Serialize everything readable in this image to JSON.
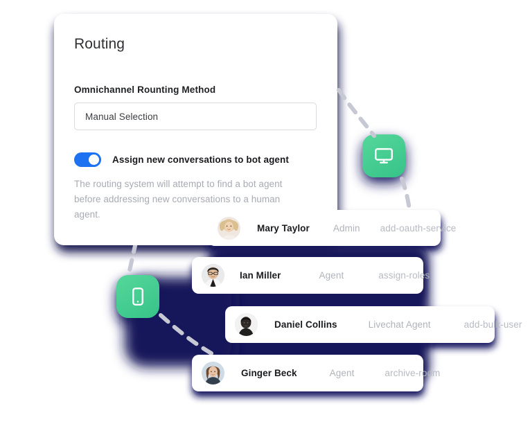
{
  "routing_panel": {
    "title": "Routing",
    "method_label": "Omnichannel Rounting Method",
    "method_value": "Manual Selection",
    "toggle_label": "Assign new conversations to bot agent",
    "toggle_state": "on",
    "helper_text": "The routing system will attempt to find a bot agent before addressing new conversations to a human agent."
  },
  "device_badges": [
    {
      "id": "desktop",
      "icon": "desktop-monitor-icon",
      "color": "#44cb90"
    },
    {
      "id": "mobile",
      "icon": "mobile-phone-icon",
      "color": "#44cb90"
    }
  ],
  "user_cards": [
    {
      "name": "Mary Taylor",
      "role": "Admin",
      "permission": "add-oauth-service"
    },
    {
      "name": "Ian Miller",
      "role": "Agent",
      "permission": "assign-roles"
    },
    {
      "name": "Daniel Collins",
      "role": "Livechat Agent",
      "permission": "add-bulk-user"
    },
    {
      "name": "Ginger Beck",
      "role": "Agent",
      "permission": "archive-room"
    }
  ],
  "colors": {
    "toggle_on": "#1c72f0",
    "accent_green": "#44cb90",
    "shadow_navy": "#141452",
    "muted_text": "#b0b3bb",
    "heading_text": "#2f3033",
    "card_background": "#ffffff",
    "page_background": "#ffffff"
  }
}
